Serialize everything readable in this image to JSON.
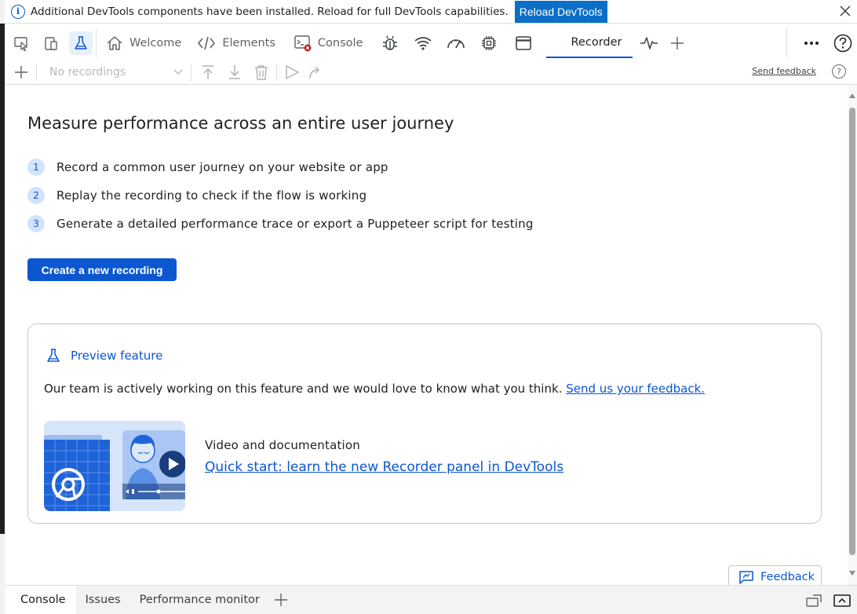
{
  "infobar": {
    "message": "Additional DevTools components have been installed. Reload for full DevTools capabilities.",
    "reload_label": "Reload DevTools"
  },
  "tabs": [
    {
      "label": "Welcome",
      "icon": "home-icon"
    },
    {
      "label": "Elements",
      "icon": "code-icon"
    },
    {
      "label": "Console",
      "icon": "console-icon"
    },
    {
      "label": "Recorder",
      "icon": "recorder-icon",
      "active": true
    }
  ],
  "recorder_toolbar": {
    "select_placeholder": "No recordings",
    "send_feedback": "Send feedback"
  },
  "main": {
    "heading": "Measure performance across an entire user journey",
    "steps": [
      {
        "num": "1",
        "text": "Record a common user journey on your website or app"
      },
      {
        "num": "2",
        "text": "Replay the recording to check if the flow is working"
      },
      {
        "num": "3",
        "text": "Generate a detailed performance trace or export a Puppeteer script for testing"
      }
    ],
    "create_button": "Create a new recording",
    "preview": {
      "label": "Preview feature",
      "text": "Our team is actively working on this feature and we would love to know what you think.",
      "link": "Send us your feedback.",
      "video_title": "Video and documentation",
      "video_link": "Quick start: learn the new Recorder panel in DevTools"
    },
    "feedback_button": "Feedback"
  },
  "drawer": {
    "tabs": [
      "Console",
      "Issues",
      "Performance monitor"
    ]
  },
  "colors": {
    "accent": "#0b57d0",
    "reload_button": "#0b6fc7"
  }
}
